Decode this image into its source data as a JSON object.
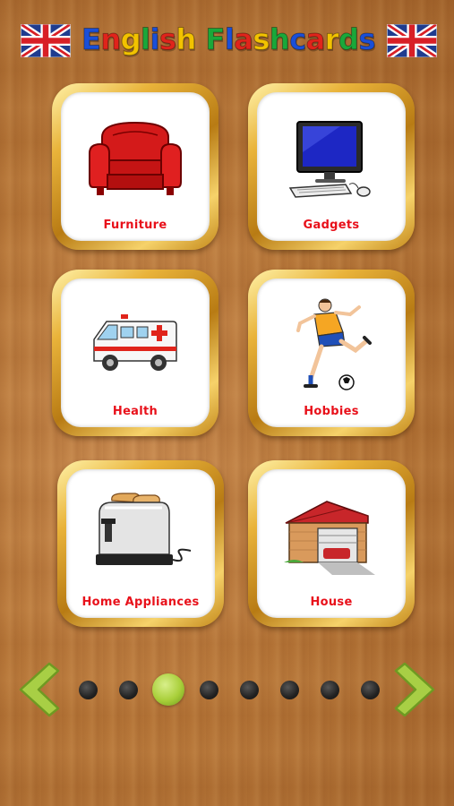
{
  "header": {
    "title_letters": [
      {
        "ch": "E",
        "color": "#1a4fd8"
      },
      {
        "ch": "n",
        "color": "#e0241b"
      },
      {
        "ch": "g",
        "color": "#f2c200"
      },
      {
        "ch": "l",
        "color": "#1aa83a"
      },
      {
        "ch": "i",
        "color": "#1a4fd8"
      },
      {
        "ch": "s",
        "color": "#e0241b"
      },
      {
        "ch": "h",
        "color": "#f2c200"
      },
      {
        "ch": " ",
        "color": "#000000"
      },
      {
        "ch": "F",
        "color": "#1aa83a"
      },
      {
        "ch": "l",
        "color": "#1a4fd8"
      },
      {
        "ch": "a",
        "color": "#e0241b"
      },
      {
        "ch": "s",
        "color": "#f2c200"
      },
      {
        "ch": "h",
        "color": "#1aa83a"
      },
      {
        "ch": "c",
        "color": "#1a4fd8"
      },
      {
        "ch": "a",
        "color": "#e0241b"
      },
      {
        "ch": "r",
        "color": "#f2c200"
      },
      {
        "ch": "d",
        "color": "#1aa83a"
      },
      {
        "ch": "s",
        "color": "#1a4fd8"
      }
    ]
  },
  "categories": [
    {
      "label": "Furniture",
      "icon": "armchair-icon"
    },
    {
      "label": "Gadgets",
      "icon": "computer-icon"
    },
    {
      "label": "Health",
      "icon": "ambulance-icon"
    },
    {
      "label": "Hobbies",
      "icon": "soccer-player-icon"
    },
    {
      "label": "Home Appliances",
      "icon": "toaster-icon"
    },
    {
      "label": "House",
      "icon": "house-icon"
    }
  ],
  "pagination": {
    "total_pages": 8,
    "current_page": 3
  },
  "colors": {
    "label": "#e8101a",
    "arrow": "#9fc83a",
    "gold": "#e2a92c"
  }
}
